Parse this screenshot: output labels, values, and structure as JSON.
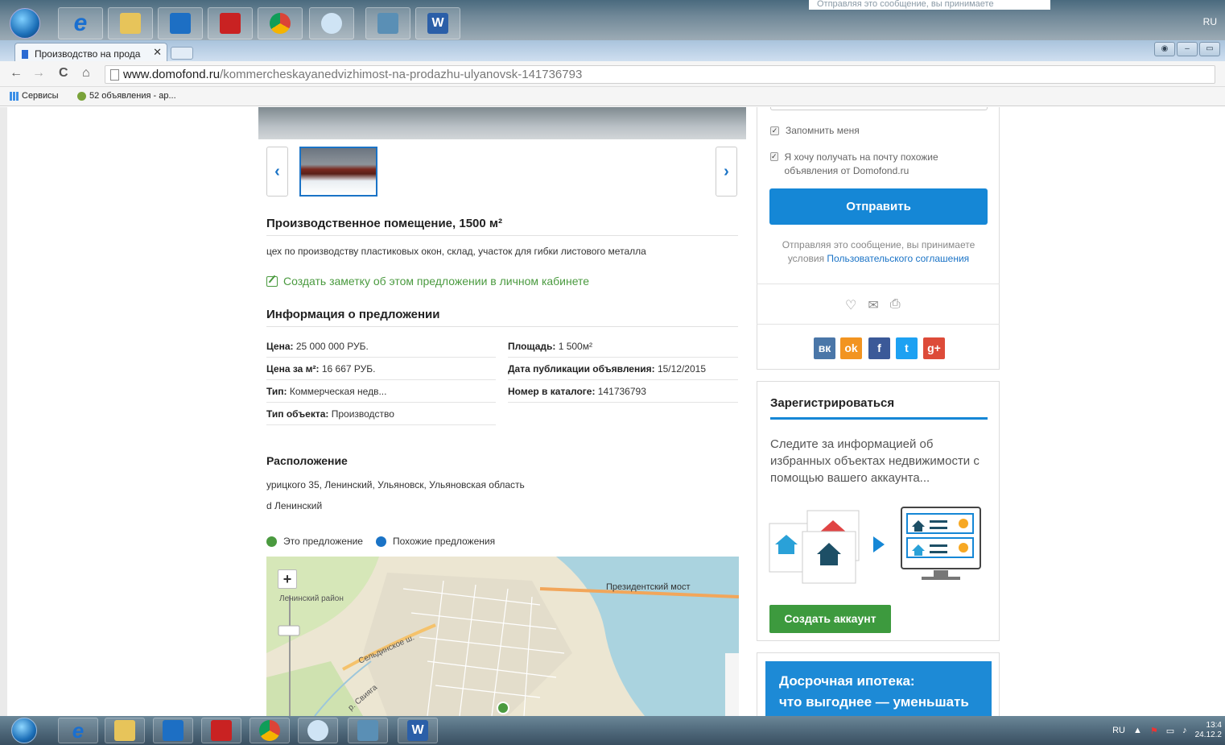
{
  "background_taskbar": {
    "ghost_note": "Отправляя это сообщение, вы принимаете",
    "lang": "RU"
  },
  "browser": {
    "tab_title": "Производство на прода",
    "tab_close": "✕",
    "url_domain": "www.domofond.ru",
    "url_path": "/kommercheskayanedvizhimost-na-prodazhu-ulyanovsk-141736793",
    "bookmarks": [
      {
        "label": "Сервисы"
      },
      {
        "label": "52 объявления - ар..."
      }
    ]
  },
  "listing": {
    "title": "Производственное помещение, 1500 м²",
    "description": "цех по производству пластиковых окон, склад, участок для гибки листового металла",
    "note_link": "Создать заметку об этом предложении в личном кабинете",
    "info_heading": "Информация о предложении",
    "info_left": [
      {
        "label": "Цена:",
        "value": " 25 000 000 РУБ."
      },
      {
        "label": "Цена за м²:",
        "value": " 16 667 РУБ."
      },
      {
        "label": "Тип:",
        "value": " Коммерческая недв..."
      },
      {
        "label": "Тип объекта:",
        "value": " Производство"
      }
    ],
    "info_right": [
      {
        "label": "Площадь:",
        "value": " 1 500м²"
      },
      {
        "label": "Дата публикации объявления:",
        "value": " 15/12/2015"
      },
      {
        "label": "Номер в каталоге:",
        "value": " 141736793"
      }
    ],
    "location_heading": "Расположение",
    "address": "урицкого 35, Ленинский, Ульяновск, Ульяновская область",
    "district": "d Ленинский",
    "legend_this": "Это предложение",
    "legend_similar": "Похожие предложения",
    "map_labels": {
      "district": "Ленинский район",
      "bridge": "Президентский мост",
      "highway": "Сельдинское ш.",
      "river": "р. Свияга"
    },
    "colors": {
      "this": "#4a9a3f",
      "similar": "#1a73c6"
    }
  },
  "sidebar": {
    "remember_me": "Запомнить меня",
    "subscribe": "Я хочу получать на почту похожие объявления от Domofond.ru",
    "send_button": "Отправить",
    "terms_prefix": "Отправляя это сообщение, вы принимаете условия ",
    "terms_link": "Пользовательского соглашения",
    "social": [
      "вк",
      "ok",
      "f",
      "t",
      "g+"
    ],
    "register_title": "Зарегистрироваться",
    "register_text": "Следите за информацией об избранных объектах недвижимости с помощью вашего аккаунта...",
    "create_account": "Создать аккаунт",
    "promo_line1": "Досрочная ипотека:",
    "promo_line2": "что выгоднее — уменьшать"
  },
  "system_tray": {
    "lang": "RU",
    "time": "13:4",
    "date": "24.12.2"
  }
}
